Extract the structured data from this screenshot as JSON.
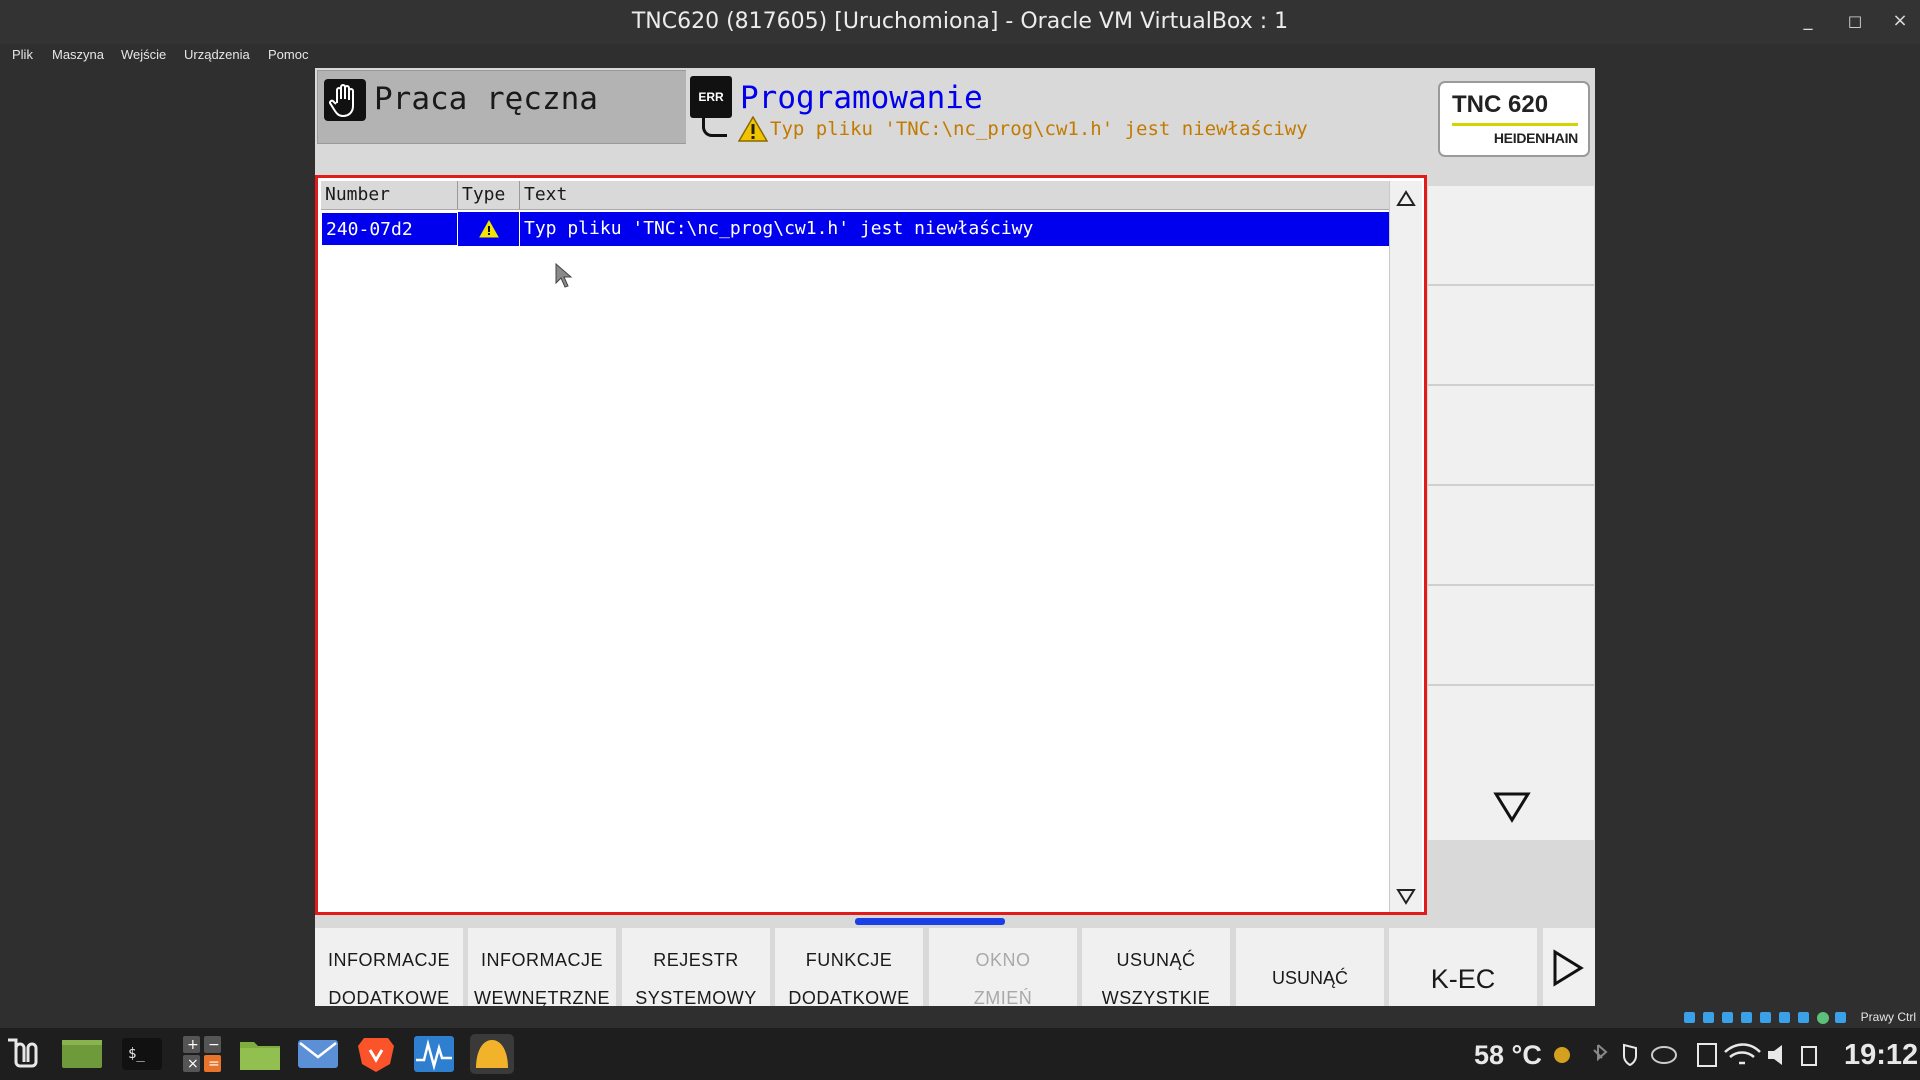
{
  "window": {
    "title": "TNC620 (817605) [Uruchomiona] - Oracle VM VirtualBox : 1",
    "controls": [
      "_",
      "□",
      "×"
    ]
  },
  "menubar": {
    "items": [
      "Plik",
      "Maszyna",
      "Wejście",
      "Urządzenia",
      "Pomoc"
    ]
  },
  "tnc": {
    "mode_left": {
      "label": "Praca ręczna",
      "icon": "hand-icon"
    },
    "mode_right": {
      "label": "Programowanie",
      "badge": "ERR",
      "warning": "Typ pliku 'TNC:\\nc_prog\\cw1.h' jest niewłaściwy"
    },
    "logo": {
      "model": "TNC 620",
      "brand": "HEIDENHAIN"
    },
    "error_table": {
      "headers": [
        "Number",
        "Type",
        "Text"
      ],
      "rows": [
        {
          "number": "240-07d2",
          "type": "warning",
          "text": "Typ pliku 'TNC:\\nc_prog\\cw1.h' jest niewłaściwy"
        }
      ]
    },
    "softkeys": [
      {
        "line1": "INFORMACJE",
        "line2": "DODATKOWE",
        "enabled": true
      },
      {
        "line1": "INFORMACJE",
        "line2": "WEWNĘTRZNE",
        "enabled": true
      },
      {
        "line1": "REJESTR",
        "line2": "SYSTEMOWY",
        "enabled": true
      },
      {
        "line1": "FUNKCJE",
        "line2": "DODATKOWE",
        "enabled": true
      },
      {
        "line1": "OKNO",
        "line2": "ZMIEŃ",
        "enabled": false
      },
      {
        "line1": "USUNĄĆ",
        "line2": "WSZYSTKIE",
        "enabled": true
      },
      {
        "label": "USUNĄĆ",
        "enabled": true
      },
      {
        "label": "K-EC",
        "enabled": true
      }
    ]
  },
  "host_status": {
    "text": "Prawy Ctrl"
  },
  "taskbar": {
    "temperature": "58 °C",
    "time": "19:12",
    "colors": {
      "bg": "#1e1e1e",
      "accent": "#0000ee",
      "warning": "#c27a00",
      "frame": "#e21a1a"
    }
  }
}
